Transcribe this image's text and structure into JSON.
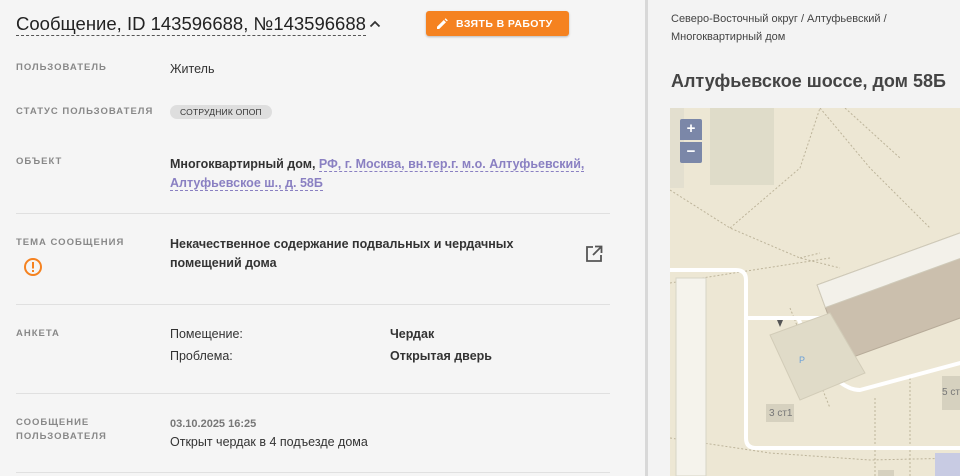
{
  "header": {
    "title": "Сообщение, ID 143596688, №143596688",
    "take_button": "ВЗЯТЬ В РАБОТУ"
  },
  "fields": {
    "user_label": "ПОЛЬЗОВАТЕЛЬ",
    "user_value": "Житель",
    "status_label": "СТАТУС ПОЛЬЗОВАТЕЛЯ",
    "status_value": "СОТРУДНИК ОПОП",
    "object_label": "ОБЪЕКТ",
    "object_type": "Многоквартирный дом, ",
    "object_link": "РФ, г. Москва, вн.тер.г. м.о. Алтуфьевский, Алтуфьевское ш., д. 58Б",
    "topic_label": "ТЕМА СООБЩЕНИЯ",
    "topic_value": "Некачественное содержание подвальных и чердачных помещений дома",
    "survey_label": "АНКЕТА",
    "survey": [
      {
        "key": "Помещение:",
        "value": "Чердак"
      },
      {
        "key": "Проблема:",
        "value": "Открытая дверь"
      }
    ],
    "message_label_1": "СООБЩЕНИЕ",
    "message_label_2": "ПОЛЬЗОВАТЕЛЯ",
    "message_date": "03.10.2025 16:25",
    "message_text": "Открыт чердак в 4 подъезде дома"
  },
  "sidebar": {
    "breadcrumb": "Северо-Восточный округ / Алтуфьевский / Многоквартирный дом",
    "address": "Алтуфьевское шоссе, дом 58Б",
    "map_labels": {
      "building_a": "3 ст1",
      "building_b": "5 ст",
      "parking": "P"
    },
    "zoom_in": "+",
    "zoom_out": "−"
  },
  "colors": {
    "accent_orange": "#f58220",
    "link_purple": "#8a80c2",
    "map_zoom": "#7b87a8"
  }
}
